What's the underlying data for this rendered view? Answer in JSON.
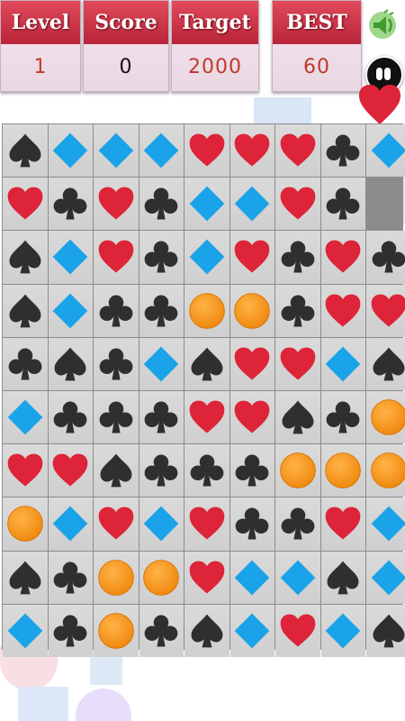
{
  "hud": {
    "level_label": "Level",
    "level_value": "1",
    "score_label": "Score",
    "score_value": "0",
    "target_label": "Target",
    "target_value": "2000",
    "best_label": "BEST",
    "best_value": "60"
  },
  "colors": {
    "spade": "#2f2f2f",
    "club": "#2f2f2f",
    "heart": "#dd2438",
    "diamond": "#1aa3e8",
    "orb": "#f08a10"
  },
  "board": [
    [
      "spade",
      "diamond",
      "diamond",
      "diamond",
      "heart",
      "heart",
      "heart",
      "club",
      "diamond"
    ],
    [
      "heart",
      "club",
      "heart",
      "club",
      "diamond",
      "diamond",
      "heart",
      "club",
      "empty"
    ],
    [
      "spade",
      "diamond",
      "heart",
      "club",
      "diamond",
      "heart",
      "club",
      "heart",
      "club"
    ],
    [
      "spade",
      "diamond",
      "club",
      "club",
      "orb",
      "orb",
      "club",
      "heart",
      "heart"
    ],
    [
      "club",
      "spade",
      "club",
      "diamond",
      "spade",
      "heart",
      "heart",
      "diamond",
      "spade"
    ],
    [
      "diamond",
      "club",
      "club",
      "club",
      "heart",
      "heart",
      "spade",
      "club",
      "orb"
    ],
    [
      "heart",
      "heart",
      "spade",
      "club",
      "club",
      "club",
      "orb",
      "orb",
      "orb"
    ],
    [
      "orb",
      "diamond",
      "heart",
      "diamond",
      "heart",
      "club",
      "club",
      "heart",
      "diamond"
    ],
    [
      "spade",
      "club",
      "orb",
      "orb",
      "heart",
      "diamond",
      "diamond",
      "spade",
      "diamond"
    ],
    [
      "diamond",
      "club",
      "orb",
      "club",
      "spade",
      "diamond",
      "heart",
      "diamond",
      "spade"
    ]
  ]
}
